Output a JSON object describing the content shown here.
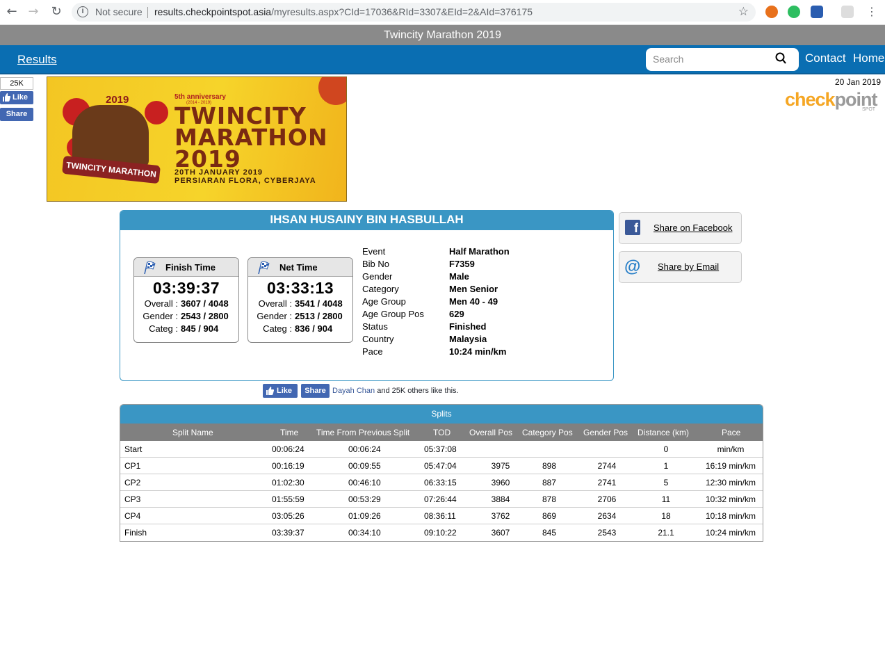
{
  "browser": {
    "security": "Not secure",
    "url_host": "results.checkpointspot.asia",
    "url_path": "/myresults.aspx?CId=17036&RId=3307&EId=2&AId=376175"
  },
  "site": {
    "title": "Twincity Marathon 2019",
    "results_link": "Results",
    "search_placeholder": "Search",
    "nav_contact": "Contact",
    "nav_home": "Home",
    "date": "20 Jan 2019",
    "logo_part1": "check",
    "logo_part2": "point",
    "logo_sub": "SPOT"
  },
  "social_side": {
    "count": "25K",
    "like": "Like",
    "share": "Share"
  },
  "banner": {
    "year_small": "2019",
    "anniversary": "5th anniversary",
    "anniversary_years": "(2014 - 2019)",
    "title_line1": "TWINCITY",
    "title_line2": "MARATHON",
    "title_line3": "2019",
    "ribbon": "TWINCITY MARATHON",
    "date": "20TH JANUARY 2019",
    "venue": "PERSIARAN FLORA, CYBERJAYA"
  },
  "runner": {
    "name": "IHSAN HUSAINY BIN HASBULLAH"
  },
  "finish_time": {
    "label": "Finish Time",
    "time": "03:39:37",
    "overall_label": "Overall :",
    "overall": "3607 / 4048",
    "gender_label": "Gender :",
    "gender": "2543 / 2800",
    "categ_label": "Categ :",
    "categ": "845 / 904"
  },
  "net_time": {
    "label": "Net Time",
    "time": "03:33:13",
    "overall_label": "Overall :",
    "overall": "3541 / 4048",
    "gender_label": "Gender :",
    "gender": "2513 / 2800",
    "categ_label": "Categ :",
    "categ": "836 / 904"
  },
  "info": [
    {
      "k": "Event",
      "v": "Half Marathon"
    },
    {
      "k": "Bib No",
      "v": "F7359"
    },
    {
      "k": "Gender",
      "v": "Male"
    },
    {
      "k": "Category",
      "v": "Men Senior"
    },
    {
      "k": "Age Group",
      "v": "Men 40 - 49"
    },
    {
      "k": "Age Group Pos",
      "v": "629"
    },
    {
      "k": "Status",
      "v": "Finished"
    },
    {
      "k": "Country",
      "v": "Malaysia"
    },
    {
      "k": "Pace",
      "v": "10:24 min/km"
    }
  ],
  "share": {
    "facebook": "Share on Facebook",
    "email": "Share by Email"
  },
  "fb_row": {
    "like": "Like",
    "share": "Share",
    "name": "Dayah Chan",
    "rest": " and 25K others like this."
  },
  "splits": {
    "title": "Splits",
    "headers": [
      "Split Name",
      "Time",
      "Time From Previous Split",
      "TOD",
      "Overall Pos",
      "Category Pos",
      "Gender Pos",
      "Distance (km)",
      "Pace"
    ],
    "rows": [
      [
        "Start",
        "00:06:24",
        "00:06:24",
        "05:37:08",
        "",
        "",
        "",
        "0",
        "min/km"
      ],
      [
        "CP1",
        "00:16:19",
        "00:09:55",
        "05:47:04",
        "3975",
        "898",
        "2744",
        "1",
        "16:19 min/km"
      ],
      [
        "CP2",
        "01:02:30",
        "00:46:10",
        "06:33:15",
        "3960",
        "887",
        "2741",
        "5",
        "12:30 min/km"
      ],
      [
        "CP3",
        "01:55:59",
        "00:53:29",
        "07:26:44",
        "3884",
        "878",
        "2706",
        "11",
        "10:32 min/km"
      ],
      [
        "CP4",
        "03:05:26",
        "01:09:26",
        "08:36:11",
        "3762",
        "869",
        "2634",
        "18",
        "10:18 min/km"
      ],
      [
        "Finish",
        "03:39:37",
        "00:34:10",
        "09:10:22",
        "3607",
        "845",
        "2543",
        "21.1",
        "10:24 min/km"
      ]
    ]
  }
}
